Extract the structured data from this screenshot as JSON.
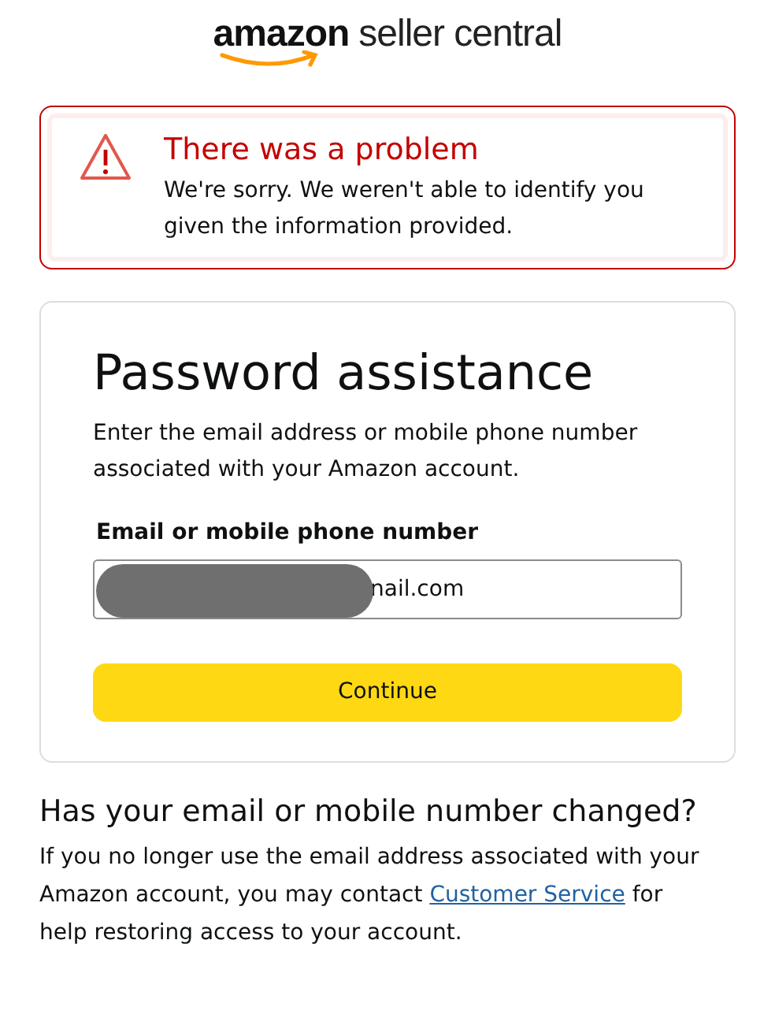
{
  "logo": {
    "brand": "amazon",
    "product": "seller central"
  },
  "alert": {
    "title": "There was a problem",
    "message": "We're sorry. We weren't able to identify you given the information provided."
  },
  "card": {
    "title": "Password assistance",
    "description": "Enter the email address or mobile phone number associated with your Amazon account.",
    "field": {
      "label": "Email or mobile phone number",
      "value": "nail.com",
      "redacted": true
    },
    "button": "Continue"
  },
  "help": {
    "heading": "Has your email or mobile number changed?",
    "text_before": "If you no longer use the email address associated with your Amazon account, you may contact",
    "link": "Customer Service",
    "text_after": "for help restoring access to your account."
  }
}
